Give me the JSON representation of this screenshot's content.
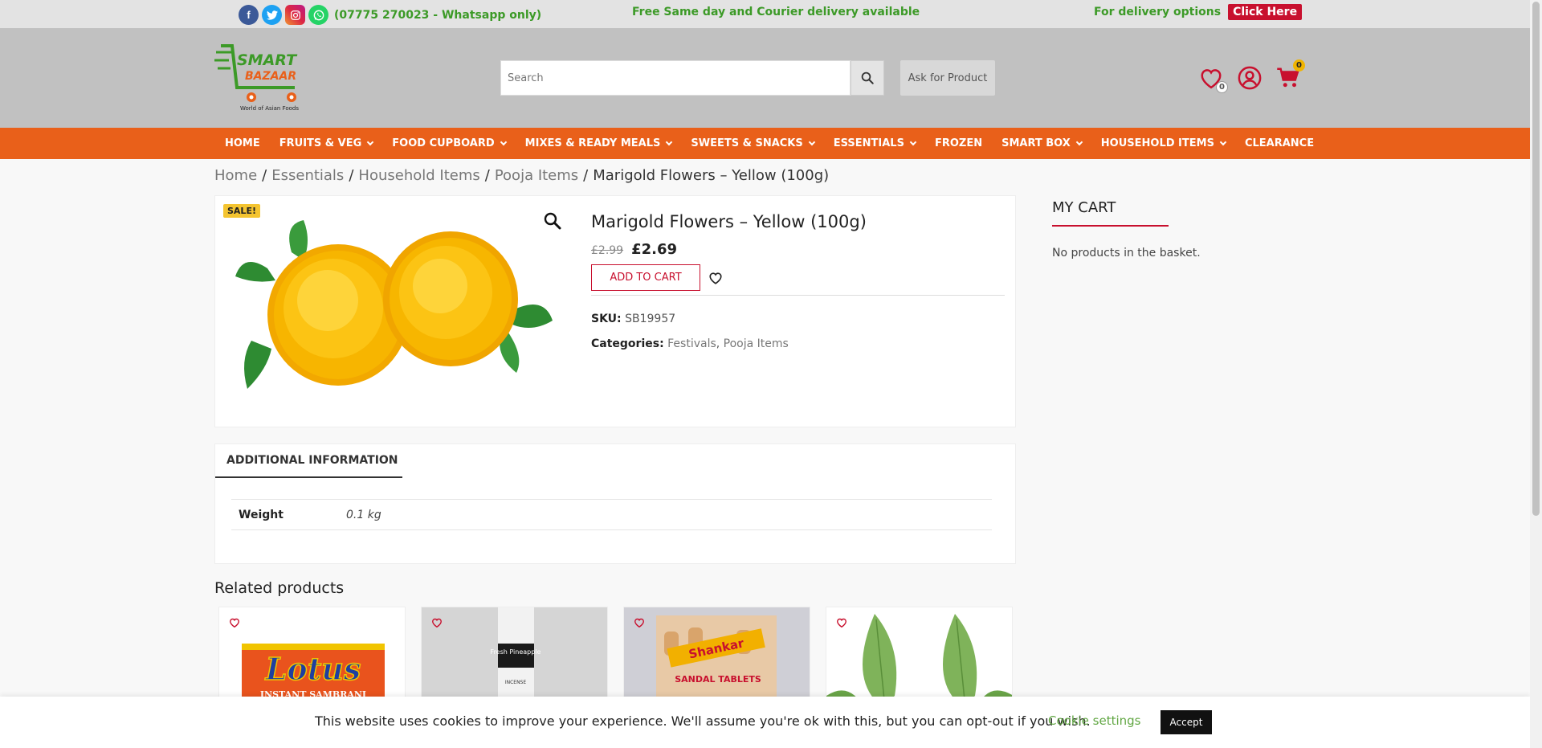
{
  "topbar": {
    "phone": "(07775 270023 - Whatsapp only)",
    "delivery_message": "Free Same day and Courier delivery available",
    "delivery_options_label": "For delivery options",
    "click_here": "Click Here",
    "social_icons": [
      "facebook-icon",
      "twitter-icon",
      "instagram-icon",
      "whatsapp-icon"
    ]
  },
  "header": {
    "logo_text_top": "SMART",
    "logo_text_bottom": "BAZAAR",
    "logo_tagline": "World of Asian Foods",
    "search_placeholder": "Search",
    "ask_button": "Ask for Product",
    "wishlist_count": "0",
    "cart_count": "0"
  },
  "nav": {
    "items": [
      {
        "label": "HOME",
        "dropdown": false
      },
      {
        "label": "FRUITS & VEG",
        "dropdown": true
      },
      {
        "label": "FOOD CUPBOARD",
        "dropdown": true
      },
      {
        "label": "MIXES & READY MEALS",
        "dropdown": true
      },
      {
        "label": "SWEETS & SNACKS",
        "dropdown": true
      },
      {
        "label": "ESSENTIALS",
        "dropdown": true
      },
      {
        "label": "FROZEN",
        "dropdown": false
      },
      {
        "label": "SMART BOX",
        "dropdown": true
      },
      {
        "label": "HOUSEHOLD ITEMS",
        "dropdown": true
      },
      {
        "label": "CLEARANCE",
        "dropdown": false
      }
    ]
  },
  "breadcrumb": {
    "items": [
      "Home",
      "Essentials",
      "Household Items",
      "Pooja Items"
    ],
    "current": "Marigold Flowers – Yellow (100g)"
  },
  "product": {
    "sale_badge": "SALE!",
    "title": "Marigold Flowers – Yellow (100g)",
    "old_price": "£2.99",
    "new_price": "£2.69",
    "add_to_cart": "ADD TO CART",
    "sku_label": "SKU:",
    "sku": "SB19957",
    "categories_label": "Categories:",
    "categories": [
      "Festivals",
      "Pooja Items"
    ]
  },
  "tabs": {
    "additional_info": "ADDITIONAL INFORMATION",
    "attributes": [
      {
        "name": "Weight",
        "value": "0.1 kg"
      }
    ]
  },
  "related": {
    "title": "Related products",
    "items": [
      {
        "label": "Lotus",
        "sublabel": "INSTANT SAMBRANI"
      },
      {
        "label": "Fresh Pineapple",
        "sublabel": "INCENSE"
      },
      {
        "label": "Shankar",
        "sublabel": "SANDAL TABLETS"
      },
      {
        "label": "",
        "sublabel": ""
      }
    ]
  },
  "sidebar": {
    "cart_title": "MY CART",
    "cart_empty": "No products in the basket."
  },
  "cookie": {
    "text": "This website uses cookies to improve your experience. We'll assume you're ok with this, but you can opt-out if you wish.",
    "settings": "Cookie settings",
    "accept": "Accept"
  },
  "colors": {
    "nav_orange": "#e9601a",
    "brand_green": "#3c9a27",
    "accent_red": "#c8102e",
    "sale_yellow": "#f4c430"
  }
}
